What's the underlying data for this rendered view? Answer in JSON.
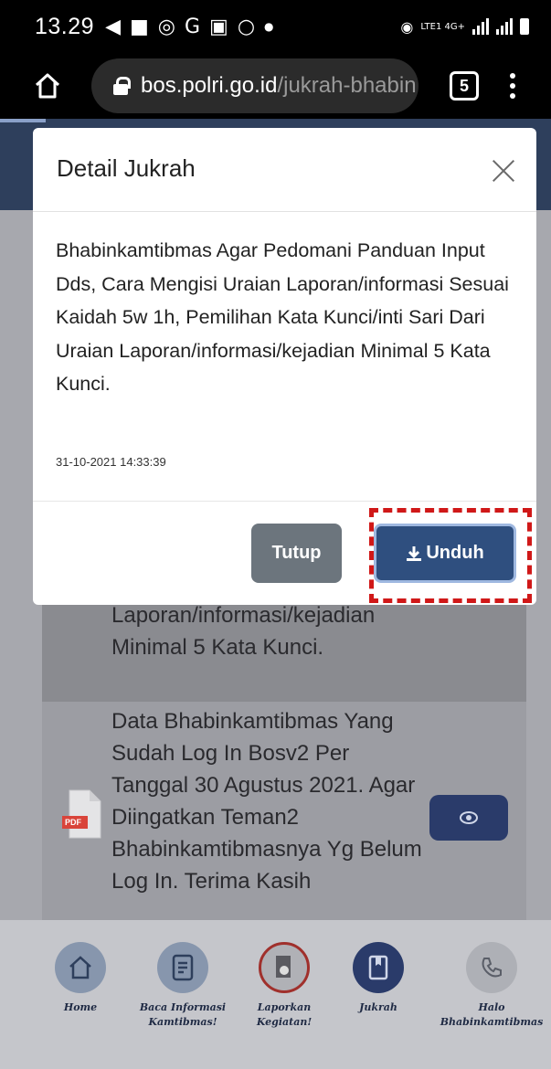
{
  "status_bar": {
    "time": "13.29",
    "network_label": "LTE1 4G+"
  },
  "browser": {
    "url_host": "bos.polri.go.id",
    "url_path": "/jukrah-bhabin",
    "tab_count": "5"
  },
  "background_list": {
    "item1_text": "Laporan/informasi/kejadian Minimal 5 Kata Kunci.",
    "item2_text": "Data Bhabinkamtibmas Yang Sudah Log In Bosv2 Per Tanggal 30 Agustus 2021. Agar Diingatkan Teman2 Bhabinkamtibmasnya Yg Belum Log In. Terima Kasih",
    "pdf_label": "PDF"
  },
  "bottom_nav": {
    "items": [
      {
        "label": "Home",
        "icon": "home-icon"
      },
      {
        "label": "Baca Informasi Kamtibmas!",
        "icon": "document-icon"
      },
      {
        "label": "Laporkan Kegiatan!",
        "icon": "report-icon"
      },
      {
        "label": "Jukrah",
        "icon": "book-icon"
      },
      {
        "label": "Halo Bhabinkamtibmas",
        "icon": "phone-icon"
      }
    ]
  },
  "modal": {
    "title": "Detail Jukrah",
    "body": "Bhabinkamtibmas Agar Pedomani Panduan Input Dds, Cara Mengisi Uraian Laporan/informasi Sesuai Kaidah 5w 1h, Pemilihan Kata Kunci/inti Sari Dari Uraian Laporan/informasi/kejadian Minimal 5 Kata Kunci.",
    "date": "31-10-2021 14:33:39",
    "close_button_label": "Tutup",
    "download_button_label": "Unduh"
  },
  "colors": {
    "primary": "#2f4f7f",
    "secondary_button": "#6c757d",
    "highlight": "#d01818"
  }
}
